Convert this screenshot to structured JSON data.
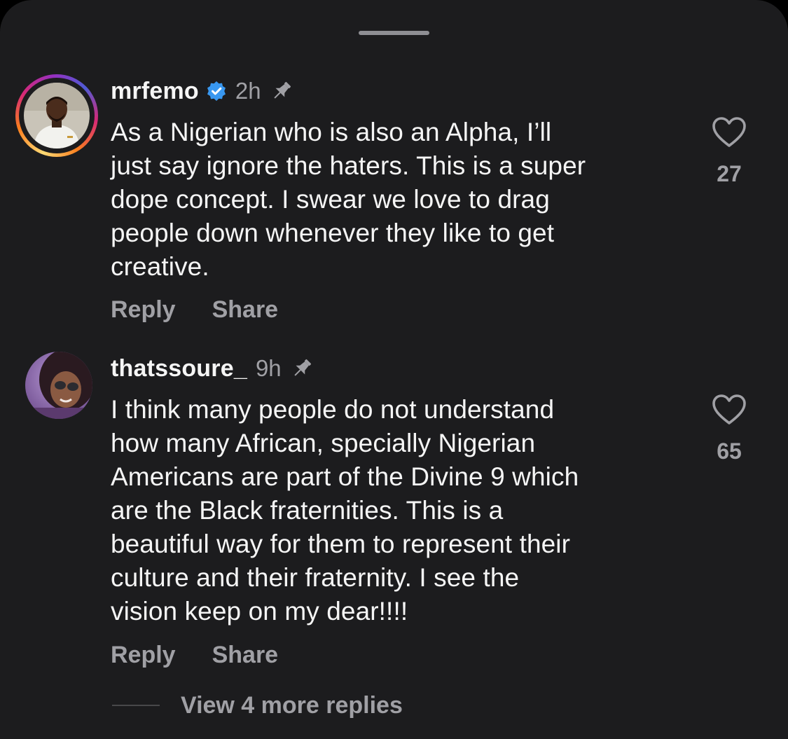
{
  "comments": [
    {
      "username": "mrfemo",
      "verified": true,
      "time": "2h",
      "pinned": true,
      "text_lines": [
        "As a Nigerian who is also an Alpha, I’ll",
        "just say ignore the haters. This is a super",
        "dope concept. I swear we love to drag",
        "people down whenever they like to get",
        "creative."
      ],
      "like_count": "27",
      "reply_label": "Reply",
      "share_label": "Share",
      "has_story_ring": true
    },
    {
      "username": "thatssoure_",
      "verified": false,
      "time": "9h",
      "pinned": true,
      "text_lines": [
        "I think many people do not understand",
        "how many African, specially Nigerian",
        "Americans are part of the Divine 9 which",
        "are the Black fraternities. This is a",
        "beautiful way for them to represent their",
        "culture and their fraternity. I see the",
        "vision keep on my dear!!!!"
      ],
      "like_count": "65",
      "reply_label": "Reply",
      "share_label": "Share",
      "has_story_ring": false
    }
  ],
  "view_more_replies": "View 4 more replies",
  "icons": {
    "verified": "verified-badge-icon",
    "pin": "pin-icon",
    "like": "heart-outline-icon"
  },
  "colors": {
    "background": "#1c1c1e",
    "primary_text": "#f5f5f5",
    "secondary_text": "#a0a0a5",
    "verified_blue": "#3897f0"
  }
}
